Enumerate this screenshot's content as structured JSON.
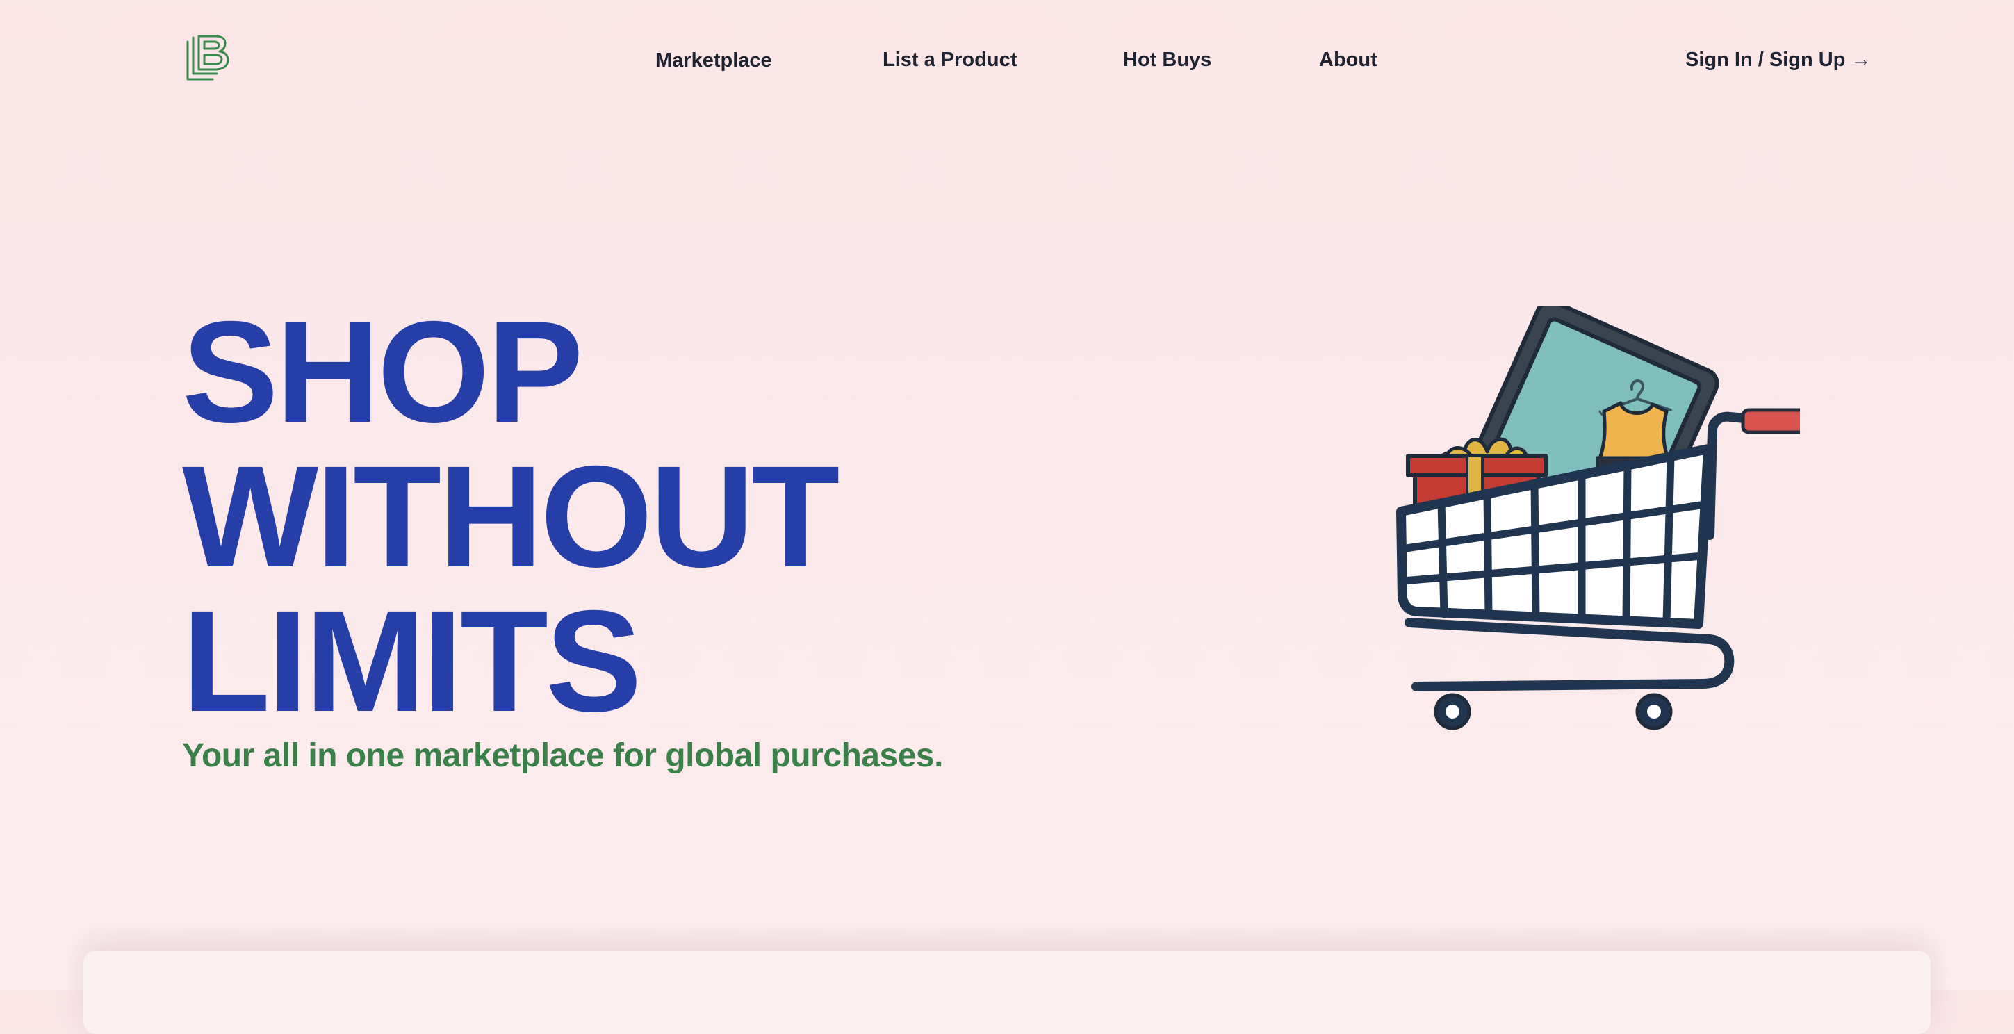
{
  "header": {
    "logo_icon": "lb-stacked-letters-logo",
    "nav": {
      "marketplace": "Marketplace",
      "list_product": "List a Product",
      "hot_buys": "Hot Buys",
      "about": "About",
      "sign_in": "Sign In / Sign Up →"
    }
  },
  "hero": {
    "title_lines": [
      "SHOP",
      "WITHOUT",
      "LIMITS"
    ],
    "subtitle": "Your all in one marketplace for global purchases.",
    "illustration": "shopping-cart-with-tablet-gift-and-dress"
  },
  "colors": {
    "background": "#fbe6e8",
    "title": "#263ea8",
    "subtitle": "#3a8048",
    "nav_text": "#1f2230",
    "logo": "#3a8a4c"
  }
}
